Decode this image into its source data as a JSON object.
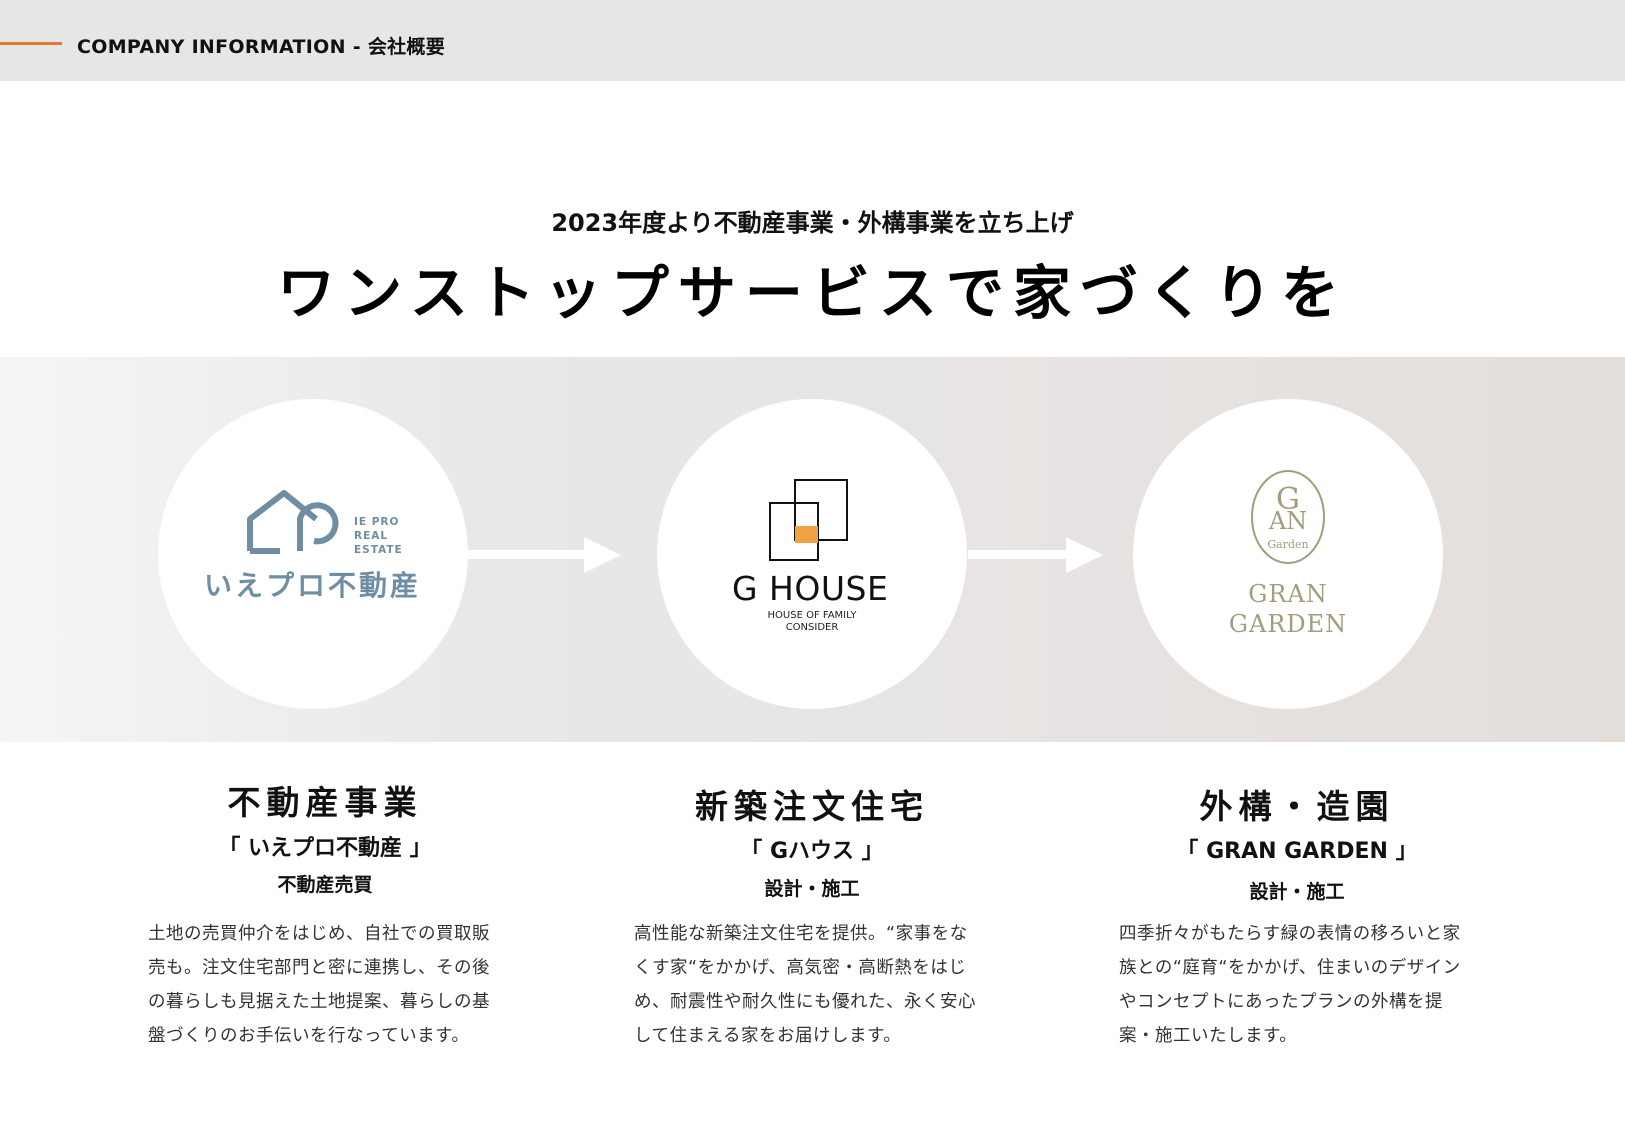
{
  "header": {
    "title": "COMPANY INFORMATION - 会社概要",
    "accent_color": "#e07a2e"
  },
  "intro": {
    "subtitle": "2023年度より不動産事業・外構事業を立ち上げ",
    "headline": "ワンストップサービスで家づくりを"
  },
  "logos": {
    "iepro": {
      "small_lines": [
        "IE PRO",
        "REAL",
        "ESTATE"
      ],
      "name": "いえプロ不動産",
      "color": "#6f8ea3"
    },
    "ghouse": {
      "name": "G HOUSE",
      "tagline_1": "HOUSE OF FAMILY",
      "tagline_2": "CONSIDER",
      "accent": "#f0a243"
    },
    "grangarden": {
      "monogram": "Garden",
      "name_1": "GRAN",
      "name_2": "GARDEN",
      "color": "#a39c7d"
    }
  },
  "columns": [
    {
      "title": "不動産事業",
      "brand": "「 いえプロ不動産 」",
      "role": "不動産売買",
      "desc": [
        "土地の売買仲介をはじめ、自社での買取販",
        "売も。注文住宅部門と密に連携し、その後",
        "の暮らしも見据えた土地提案、暮らしの基",
        "盤づくりのお手伝いを行なっています。"
      ]
    },
    {
      "title": "新築注文住宅",
      "brand": "「 Gハウス 」",
      "role": "設計・施工",
      "desc": [
        "高性能な新築注文住宅を提供。“家事をな",
        "くす家“をかかげ、高気密・高断熱をはじ",
        "め、耐震性や耐久性にも優れた、永く安心",
        "して住まえる家をお届けします。"
      ]
    },
    {
      "title": "外構・造園",
      "brand": "「 GRAN GARDEN 」",
      "role": "設計・施工",
      "desc": [
        "四季折々がもたらす緑の表情の移ろいと家",
        "族との“庭育“をかかげ、住まいのデザイン",
        "やコンセプトにあったプランの外構を提",
        "案・施工いたします。"
      ]
    }
  ]
}
